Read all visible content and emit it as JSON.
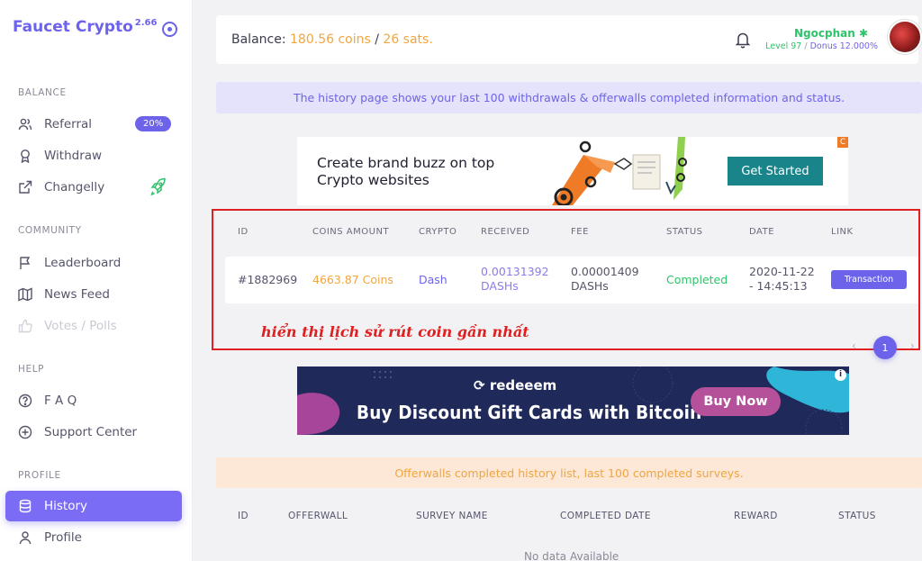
{
  "app": {
    "name": "Faucet Crypto",
    "version": "2.66"
  },
  "sidebar": {
    "sections": [
      {
        "title": "BALANCE"
      },
      {
        "title": "COMMUNITY"
      },
      {
        "title": "HELP"
      },
      {
        "title": "PROFILE"
      }
    ],
    "items": [
      {
        "label": "Referral",
        "icon": "users-icon",
        "badge": "20%"
      },
      {
        "label": "Withdraw",
        "icon": "award-icon"
      },
      {
        "label": "Changelly",
        "icon": "external-link-icon"
      },
      {
        "label": "Leaderboard",
        "icon": "flag-icon"
      },
      {
        "label": "News Feed",
        "icon": "map-icon"
      },
      {
        "label": "Votes / Polls",
        "icon": "thumbs-up-icon",
        "disabled": true
      },
      {
        "label": "F A Q",
        "icon": "question-circle-icon"
      },
      {
        "label": "Support Center",
        "icon": "plus-circle-icon"
      },
      {
        "label": "History",
        "icon": "database-icon",
        "active": true
      },
      {
        "label": "Profile",
        "icon": "user-icon"
      }
    ]
  },
  "header": {
    "balance_label": "Balance:",
    "coins": "180.56 coins",
    "separator": "/",
    "sats": "26 sats.",
    "user": {
      "name": "Ngocphan",
      "level": "Level 97",
      "sep": "/",
      "bonus": "Donus 12.000%"
    }
  },
  "history_notice": "The history page shows your last 100 withdrawals & offerwalls completed information and status.",
  "ad_top": {
    "text": "Create brand buzz on top\nCrypto websites",
    "cta": "Get Started",
    "corner": "C"
  },
  "withdrawals": {
    "columns": [
      "ID",
      "COINS AMOUNT",
      "CRYPTO",
      "RECEIVED",
      "FEE",
      "STATUS",
      "DATE",
      "LINK"
    ],
    "rows": [
      {
        "id": "#1882969",
        "coins": "4663.87 Coins",
        "crypto": "Dash",
        "received": "0.00131392\nDASHs",
        "fee": "0.00001409\nDASHs",
        "status": "Completed",
        "date": "2020-11-22\n- 14:45:13",
        "link": "Transaction"
      }
    ],
    "annotation": "hiển thị lịch sử rút coin gần nhất",
    "pagination": {
      "prev": "‹",
      "current": "1",
      "next": "›"
    }
  },
  "ad_bottom": {
    "brand": "redeeem",
    "headline": "Buy Discount Gift Cards with Bitcoin",
    "cta": "Buy Now",
    "info": "i"
  },
  "offerwall_notice": "Offerwalls completed history list, last 100 completed surveys.",
  "offerwalls": {
    "columns": [
      "ID",
      "OFFERWALL",
      "SURVEY NAME",
      "COMPLETED DATE",
      "REWARD",
      "STATUS"
    ],
    "empty": "No data Available"
  },
  "colors": {
    "accent": "#6c63ea",
    "orange": "#f0a640",
    "green": "#2ec36a",
    "annotation_red": "#e02020"
  }
}
